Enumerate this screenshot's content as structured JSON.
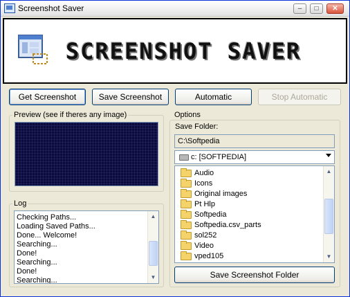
{
  "window": {
    "title": "Screenshot Saver"
  },
  "banner": {
    "text": "SCREENSHOT SAVER"
  },
  "toolbar": {
    "get_label": "Get Screenshot",
    "save_label": "Save Screenshot",
    "automatic_label": "Automatic",
    "stop_label": "Stop Automatic"
  },
  "preview": {
    "label": "Preview (see if theres any image)"
  },
  "log": {
    "label": "Log",
    "lines": [
      "Checking Paths...",
      "Loading Saved Paths...",
      "Done... Welcome!",
      "Searching...",
      "Done!",
      "Searching...",
      "Done!",
      "Searching..."
    ]
  },
  "options": {
    "label": "Options",
    "save_folder_label": "Save Folder:",
    "save_folder_value": "C:\\Softpedia",
    "drive": "c: [SOFTPEDIA]",
    "folders": [
      "Audio",
      "Icons",
      "Original images",
      "Pt Hlp",
      "Softpedia",
      "Softpedia.csv_parts",
      "sol252",
      "Video",
      "vped105"
    ],
    "save_folder_button": "Save Screenshot Folder"
  },
  "colors": {
    "accent": "#0831d9",
    "preview_bg": "#0b0b3a",
    "window_bg": "#ece9d8"
  }
}
